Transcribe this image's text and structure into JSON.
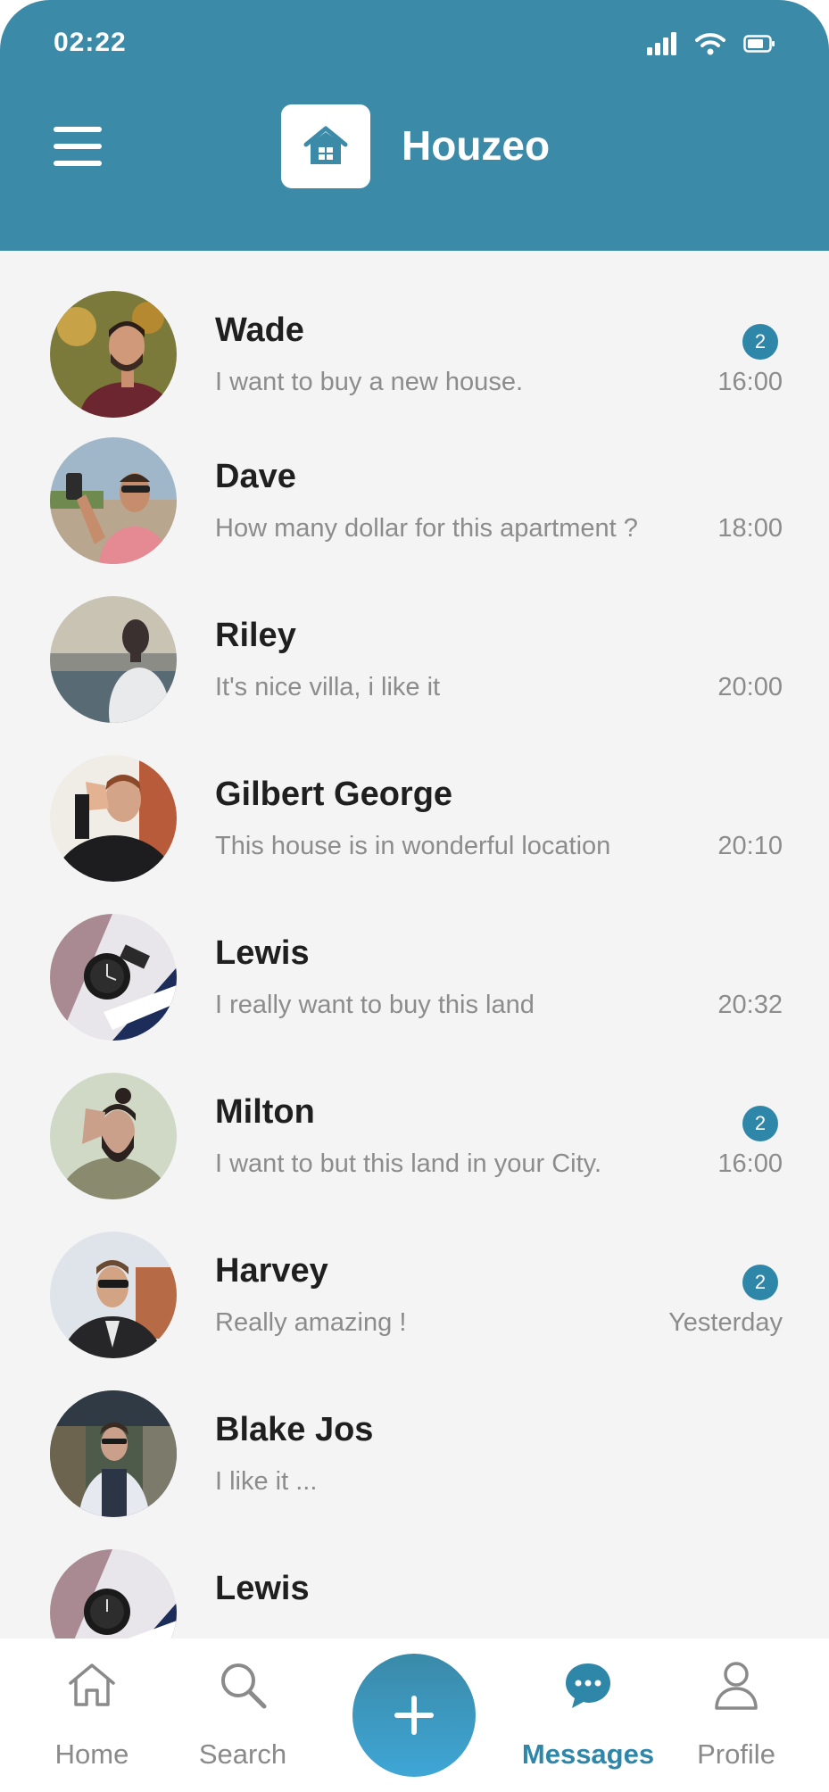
{
  "status_bar": {
    "time": "02:22"
  },
  "header": {
    "brand": "Houzeo"
  },
  "chats": [
    {
      "name": "Wade",
      "message": "I want to buy a new house.",
      "time": "16:00",
      "unread": "2"
    },
    {
      "name": "Dave",
      "message": "How many dollar for this apartment ?",
      "time": "18:00",
      "unread": ""
    },
    {
      "name": "Riley",
      "message": "It's nice villa, i like it",
      "time": "20:00",
      "unread": ""
    },
    {
      "name": "Gilbert George",
      "message": "This house is in wonderful location",
      "time": "20:10",
      "unread": ""
    },
    {
      "name": "Lewis",
      "message": "I really want to buy this land",
      "time": "20:32",
      "unread": ""
    },
    {
      "name": "Milton",
      "message": "I want to but this land in your City.",
      "time": "16:00",
      "unread": "2"
    },
    {
      "name": "Harvey",
      "message": "Really amazing !",
      "time": "Yesterday",
      "unread": "2"
    },
    {
      "name": "Blake Jos",
      "message": "I like it ...",
      "time": "",
      "unread": ""
    },
    {
      "name": "Lewis",
      "message": "",
      "time": "",
      "unread": ""
    }
  ],
  "nav": {
    "home": "Home",
    "search": "Search",
    "messages": "Messages",
    "profile": "Profile",
    "active": "messages"
  },
  "colors": {
    "primary": "#3a8aa8",
    "badge": "#2e86a8",
    "background": "#f4f4f5"
  },
  "icons": [
    "menu-icon",
    "house-logo-icon",
    "signal-icon",
    "wifi-icon",
    "battery-icon",
    "home-icon",
    "search-icon",
    "plus-icon",
    "chat-bubble-icon",
    "user-icon"
  ]
}
